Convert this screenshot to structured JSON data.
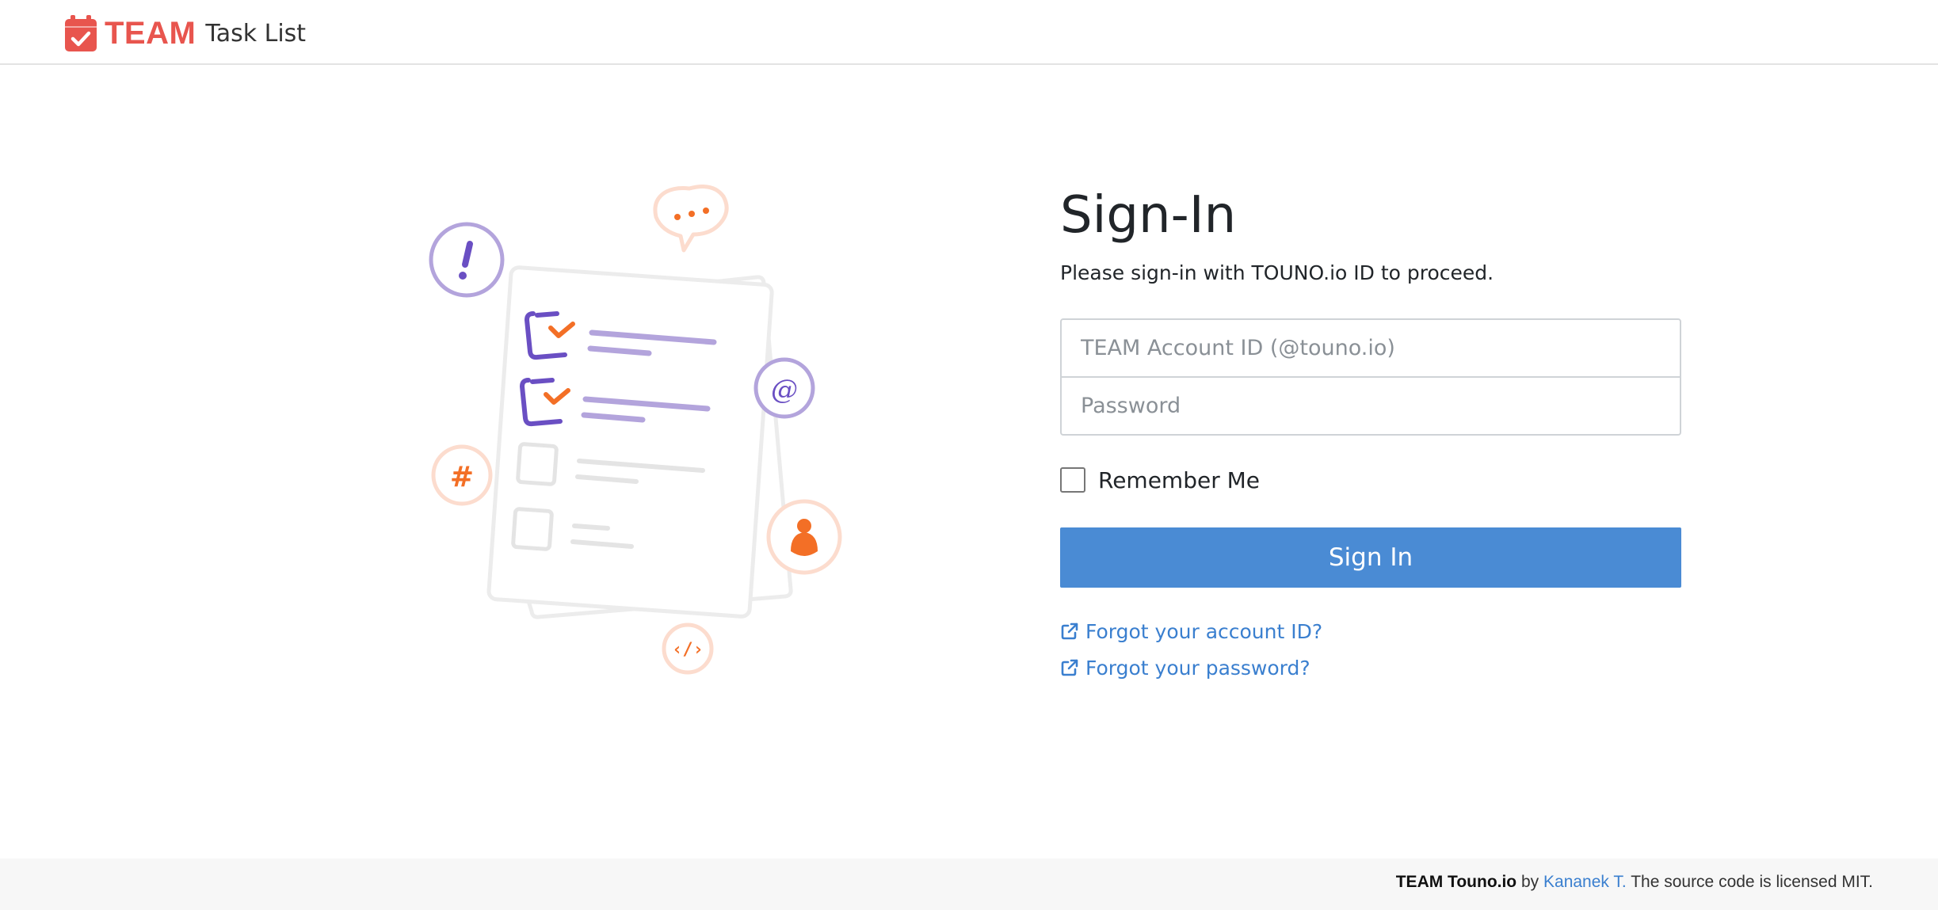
{
  "header": {
    "brand_name": "TEAM",
    "brand_subtitle": "Task List",
    "brand_icon": "calendar-check-icon",
    "brand_color": "#e8554e"
  },
  "signin": {
    "title": "Sign-In",
    "subtitle": "Please sign-in with TOUNO.io ID to proceed.",
    "account_placeholder": "TEAM Account ID (@touno.io)",
    "account_value": "",
    "password_placeholder": "Password",
    "password_value": "",
    "remember_label": "Remember Me",
    "remember_checked": false,
    "button_label": "Sign In",
    "button_color": "#4a8bd4",
    "forgot_account_label": "Forgot your account ID?",
    "forgot_password_label": "Forgot your password?",
    "link_icon": "external-link-icon"
  },
  "footer": {
    "product": "TEAM Touno.io",
    "by": "by",
    "author": "Kananek T.",
    "license": "The source code is licensed MIT."
  }
}
